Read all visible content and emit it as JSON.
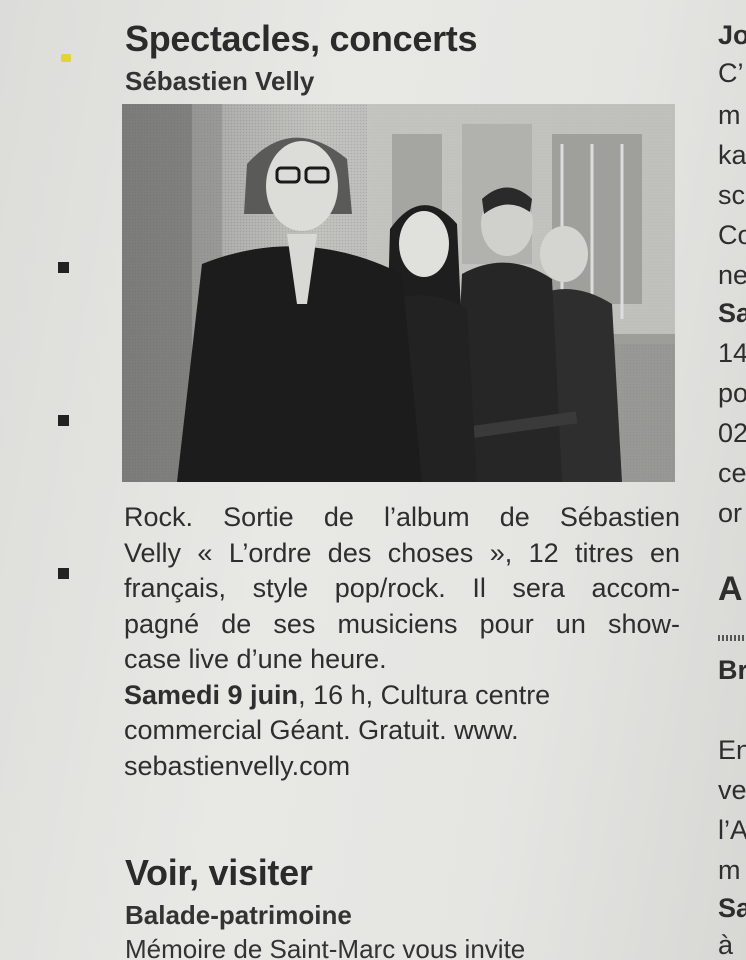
{
  "main": {
    "section_title": "Spectacles, concerts",
    "event_title": "Sébastien Velly",
    "photo_alt": "",
    "body_lines": [
      "Rock. Sortie de l’album de Sébastien",
      "Velly « L’ordre des choses », 12 titres en",
      "français, style pop/rock. Il sera accom-",
      "pagné de ses musiciens pour un show-",
      "case live d’une heure."
    ],
    "date_bold": "Samedi 9 juin",
    "date_rest": ", 16 h, Cultura centre",
    "location_line": "commercial Géant. Gratuit. www.",
    "website": "sebastienvelly.com",
    "section2_title": "Voir, visiter",
    "section2_sub": "Balade-patrimoine",
    "section2_first_line": "Mémoire de Saint-Marc vous invite"
  },
  "right_column": {
    "fragments": [
      "Jo",
      "C’",
      "m",
      "ka",
      "sc",
      "Co",
      "ne",
      "Sa",
      "14",
      "po",
      "02",
      "ce",
      "or",
      "A",
      "Br",
      "En",
      "ve",
      "l’A",
      "m",
      "Sa",
      "à"
    ]
  }
}
